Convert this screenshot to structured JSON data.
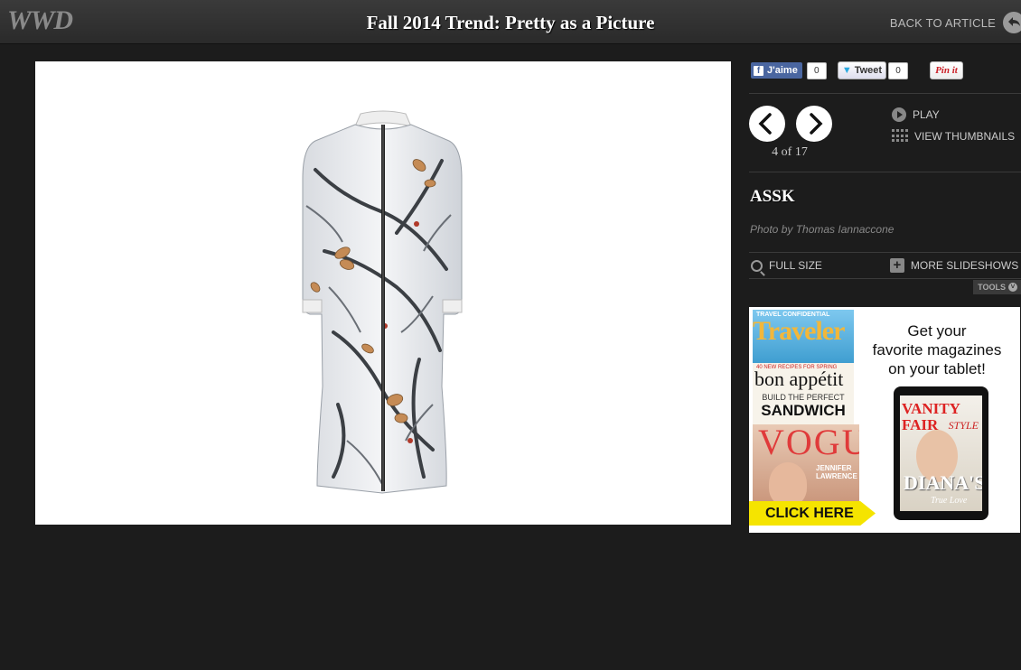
{
  "header": {
    "logo": "WWD",
    "title": "Fall 2014 Trend: Pretty as a Picture",
    "back_label": "BACK TO ARTICLE"
  },
  "social": {
    "like_label": "J'aime",
    "like_count": "0",
    "tweet_label": "Tweet",
    "tweet_count": "0",
    "pin_label": "Pin it"
  },
  "slideshow": {
    "counter": "4 of 17",
    "play_label": "PLAY",
    "thumbnails_label": "VIEW THUMBNAILS",
    "designer": "ASSK",
    "credit": "Photo by Thomas Iannaccone",
    "full_size_label": "FULL SIZE",
    "more_label": "MORE SLIDESHOWS",
    "tools_label": "TOOLS"
  },
  "ad": {
    "line1": "Get your",
    "line2": "favorite magazines",
    "line3": "on your tablet!",
    "cta": "CLICK HERE",
    "mag1_top": "TRAVEL CONFIDENTIAL",
    "mag1": "Traveler",
    "mag2": "bon appétit",
    "mag2_top": "40 NEW RECIPES FOR SPRING",
    "mag2_sub": "BUILD THE PERFECT",
    "mag2_big": "SANDWICH",
    "mag3": "VOGUE",
    "mag3_name": "JENNIFER LAWRENCE",
    "tablet_mag": "VANITY FAIR",
    "tablet_style": "STYLE",
    "tablet_cover": "DIANA'S",
    "tablet_sub": "True Love"
  },
  "colors": {
    "background": "#1c1c1c",
    "header": "#333333",
    "facebook": "#4a66a0",
    "pinterest": "#cb2027",
    "cta_yellow": "#f5e400"
  }
}
